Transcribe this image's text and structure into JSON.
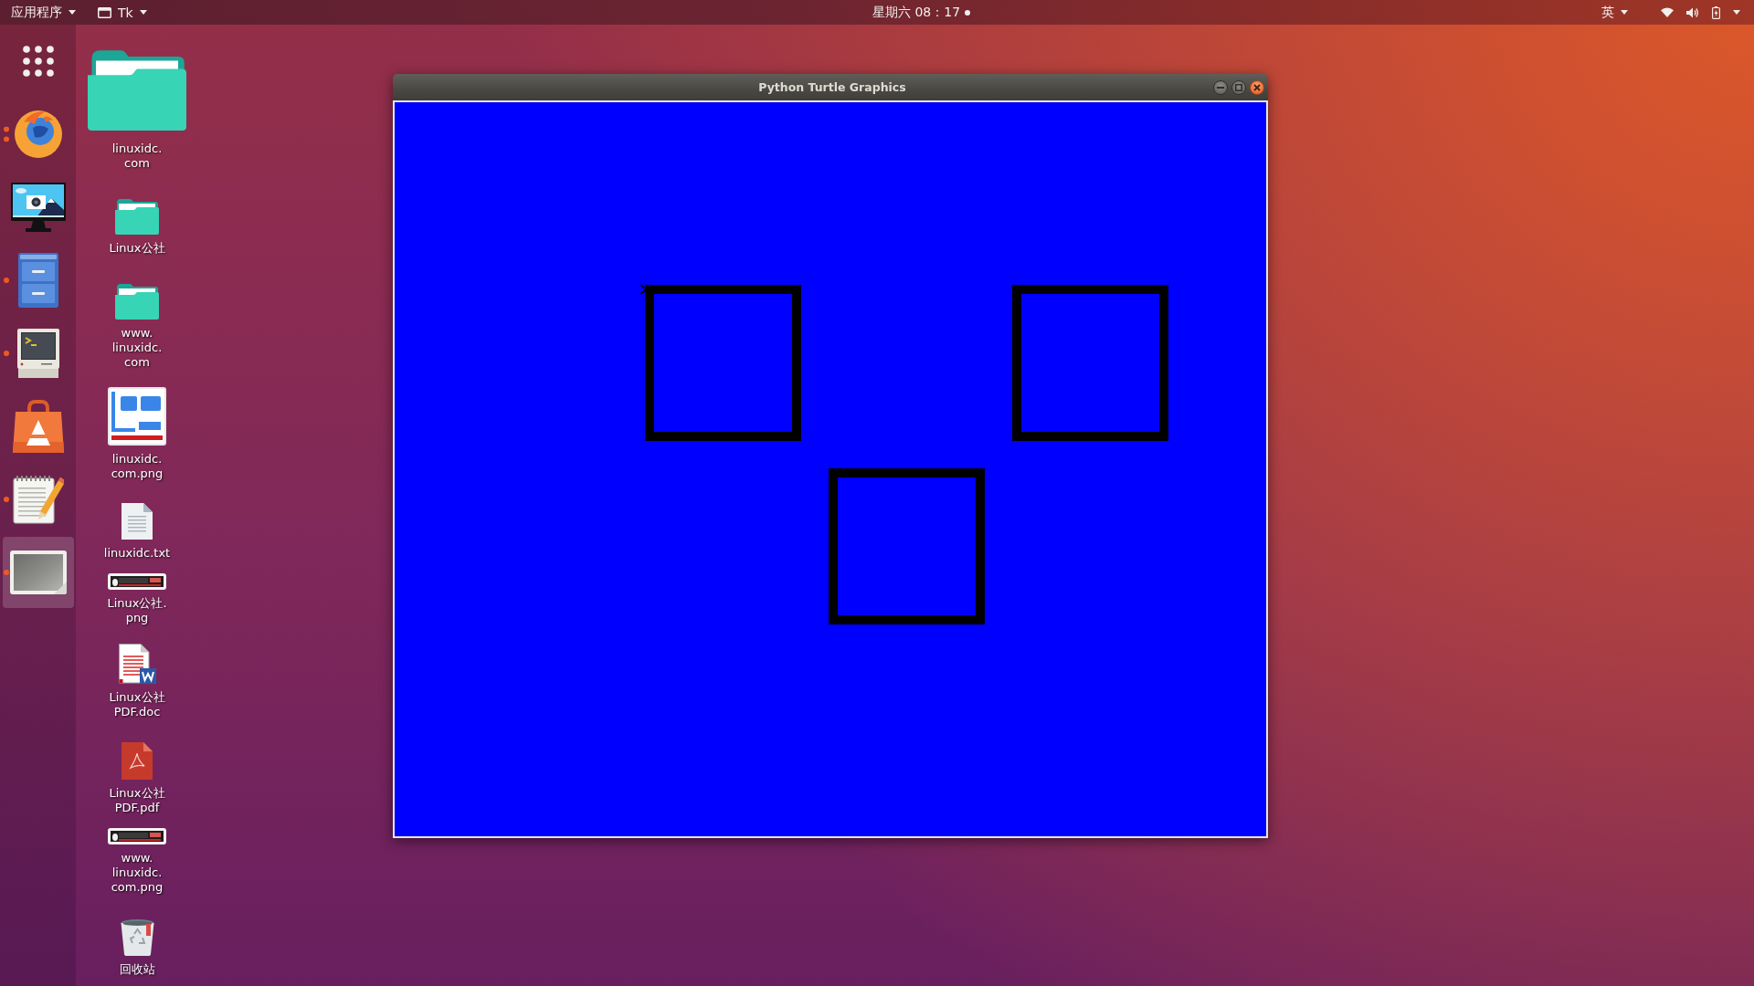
{
  "top_bar": {
    "applications_menu": {
      "label": "应用程序"
    },
    "app_menu": {
      "label": "Tk"
    },
    "clock": {
      "label": "星期六 08：17",
      "unread_notifications": true
    },
    "input_method": {
      "label": "英"
    }
  },
  "dock": {
    "items": [
      {
        "kind": "apps",
        "selected": false,
        "running": false,
        "multiple_windows": false
      },
      {
        "kind": "browser",
        "selected": false,
        "running": true,
        "multiple_windows": true
      },
      {
        "kind": "screenshot",
        "selected": false,
        "running": false,
        "multiple_windows": false
      },
      {
        "kind": "files",
        "selected": false,
        "running": true,
        "multiple_windows": false
      },
      {
        "kind": "terminal",
        "selected": false,
        "running": true,
        "multiple_windows": false
      },
      {
        "kind": "software",
        "selected": false,
        "running": false,
        "multiple_windows": false
      },
      {
        "kind": "editor",
        "selected": false,
        "running": true,
        "multiple_windows": false
      },
      {
        "kind": "viewer",
        "selected": true,
        "running": true,
        "multiple_windows": false
      }
    ]
  },
  "desktop": {
    "icons": [
      {
        "kind": "folder",
        "large": true,
        "label": "linuxidc.com"
      },
      {
        "kind": "folder",
        "large": false,
        "label": "Linux公社"
      },
      {
        "kind": "folder",
        "large": false,
        "label": "www.linuxidc.com"
      },
      {
        "kind": "thumbnail",
        "large": false,
        "label": "linuxidc.com.png"
      },
      {
        "kind": "text",
        "large": false,
        "label": "linuxidc.txt"
      },
      {
        "kind": "banner",
        "large": false,
        "label": "Linux公社.png"
      },
      {
        "kind": "document",
        "large": false,
        "label": "Linux公社PDF.doc"
      },
      {
        "kind": "pdf",
        "large": false,
        "label": "Linux公社PDF.pdf"
      },
      {
        "kind": "banner",
        "large": false,
        "label": "www.linuxidc.com.png"
      },
      {
        "kind": "trash",
        "large": false,
        "label": "回收站"
      }
    ]
  },
  "window": {
    "title": "Python Turtle Graphics"
  }
}
